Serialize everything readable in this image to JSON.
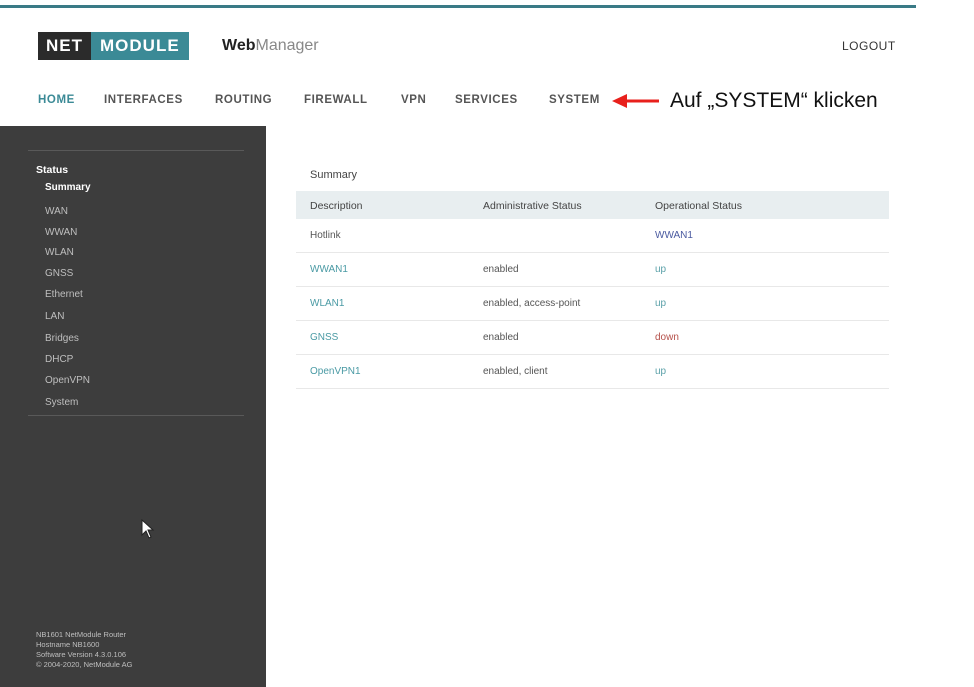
{
  "header": {
    "logo_net": "NET",
    "logo_module": "MODULE",
    "app_bold": "Web",
    "app_light": "Manager",
    "logout": "LOGOUT"
  },
  "nav": {
    "items": [
      "HOME",
      "INTERFACES",
      "ROUTING",
      "FIREWALL",
      "VPN",
      "SERVICES",
      "SYSTEM"
    ],
    "active": "HOME"
  },
  "annotation": {
    "text": "Auf „SYSTEM“ klicken",
    "arrow_color": "#e8201c"
  },
  "sidebar": {
    "section": "Status",
    "items": [
      "Summary",
      "WAN",
      "WWAN",
      "WLAN",
      "GNSS",
      "Ethernet",
      "LAN",
      "Bridges",
      "DHCP",
      "OpenVPN",
      "System"
    ],
    "active": "Summary",
    "footer": [
      "NB1601 NetModule Router",
      "Hostname NB1600",
      "Software Version 4.3.0.106",
      "© 2004-2020, NetModule AG"
    ]
  },
  "summary": {
    "title": "Summary",
    "columns": [
      "Description",
      "Administrative Status",
      "Operational Status"
    ],
    "rows": [
      {
        "description": "Hotlink",
        "admin": "",
        "oper": "WWAN1"
      },
      {
        "description": "WWAN1",
        "admin": "enabled",
        "oper": "up"
      },
      {
        "description": "WLAN1",
        "admin": "enabled, access-point",
        "oper": "up"
      },
      {
        "description": "GNSS",
        "admin": "enabled",
        "oper": "down"
      },
      {
        "description": "OpenVPN1",
        "admin": "enabled, client",
        "oper": "up"
      }
    ]
  },
  "colors": {
    "accent": "#3b8a96",
    "link": "#4a9aa4",
    "status_up": "#5aa0a8",
    "status_down": "#b5504a",
    "hotlink_target": "#4a5aa0",
    "sidebar_bg": "#3d3d3d"
  },
  "icons": {
    "annotation_arrow": "left-arrow-icon",
    "mouse_cursor": "mouse-pointer-icon"
  }
}
